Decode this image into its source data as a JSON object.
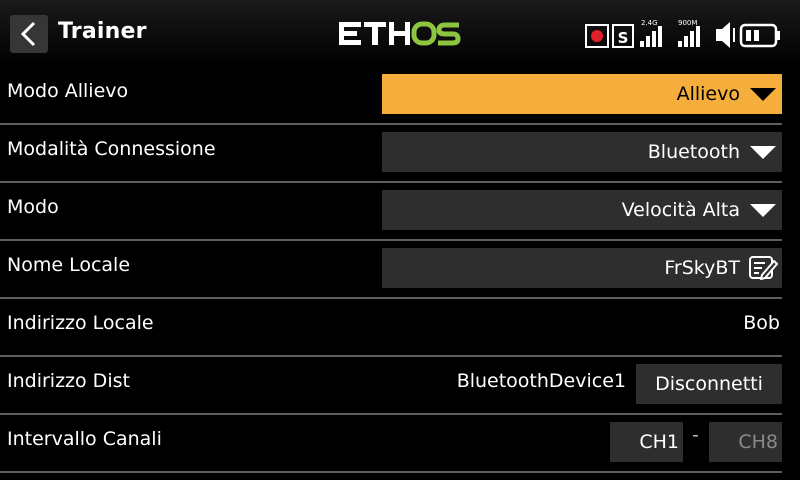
{
  "header": {
    "title": "Trainer",
    "logo_text": "ETHOS",
    "accent_color": "#8cc63f",
    "status": {
      "rssi1_label": "2.4G",
      "rssi2_label": "900M",
      "sim_icon": "S"
    }
  },
  "rows": [
    {
      "label": "Modo Allievo",
      "value": "Allievo",
      "type": "dropdown-active"
    },
    {
      "label": "Modalità Connessione",
      "value": "Bluetooth",
      "type": "dropdown"
    },
    {
      "label": "Modo",
      "value": "Velocità Alta",
      "type": "dropdown"
    },
    {
      "label": "Nome Locale",
      "value": "FrSkyBT",
      "type": "text-edit"
    },
    {
      "label": "Indirizzo Locale",
      "value": "Bob",
      "type": "static"
    },
    {
      "label": "Indirizzo Dist",
      "value": "BluetoothDevice1",
      "button": "Disconnetti",
      "type": "static-button"
    },
    {
      "label": "Intervallo Canali",
      "start": "CH1",
      "separator": "-",
      "end": "CH8",
      "type": "range"
    }
  ],
  "colors": {
    "active_field": "#f5ae3b",
    "field_bg": "#2e2e2e",
    "divider": "#5e5e5e"
  }
}
